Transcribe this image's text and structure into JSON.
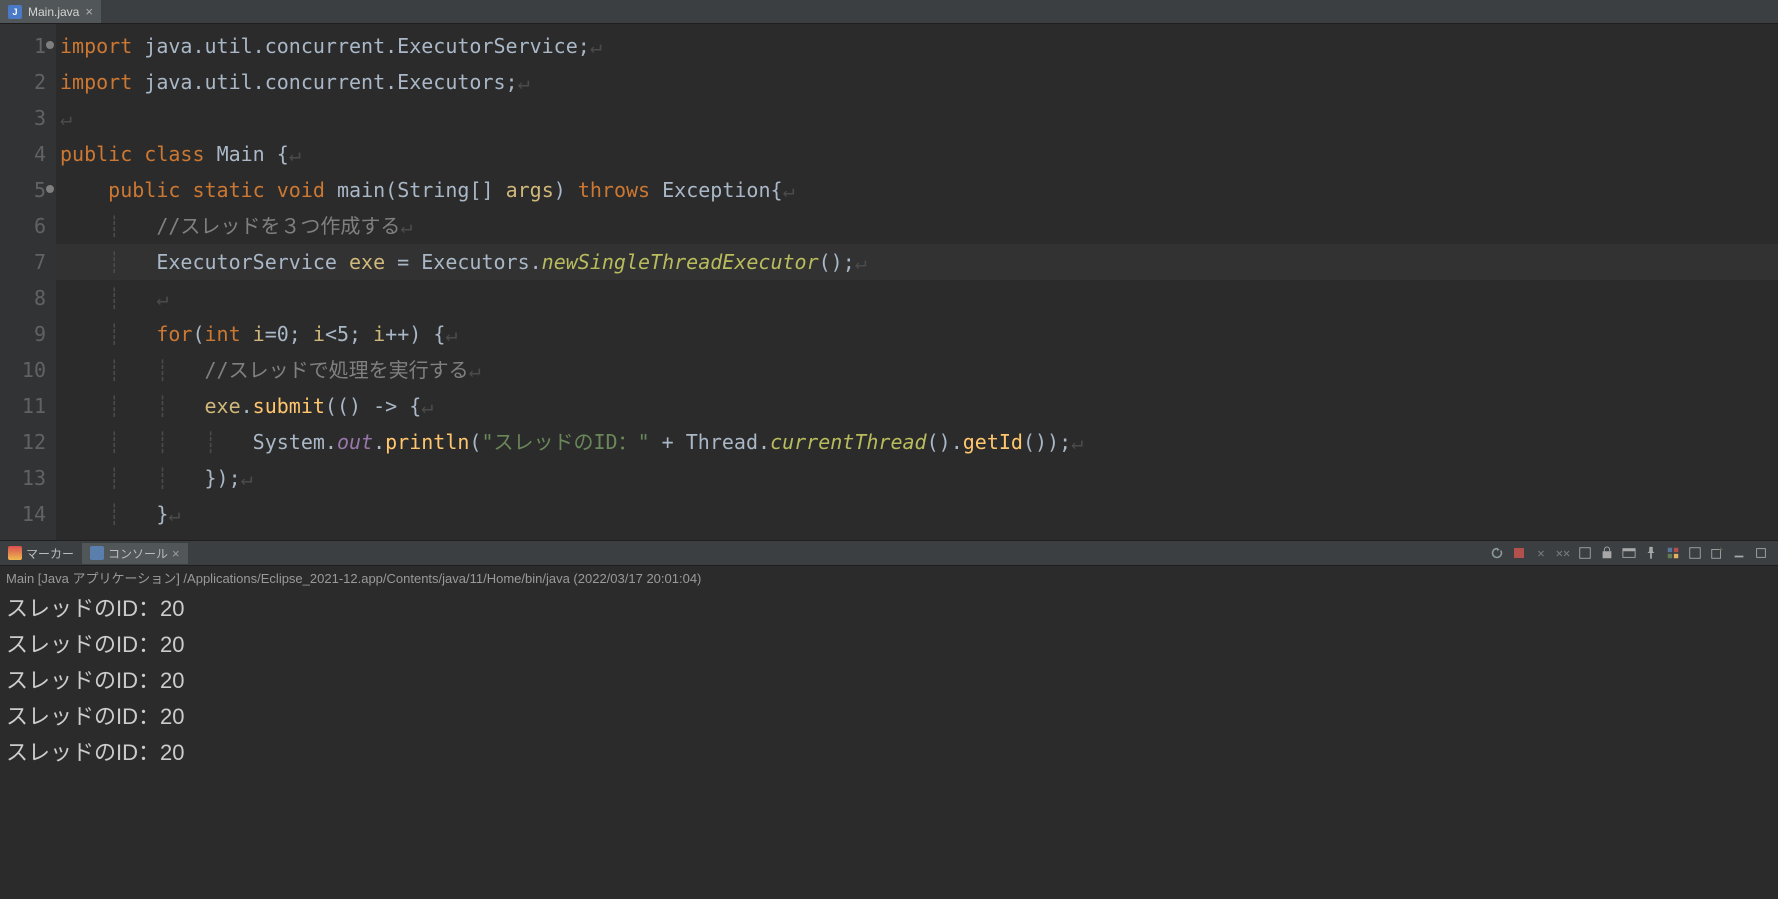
{
  "editor": {
    "tab": {
      "filename": "Main.java",
      "icon_letter": "J"
    },
    "lines": [
      {
        "n": 1,
        "mark": true,
        "tokens": [
          {
            "t": "kw",
            "s": "import"
          },
          {
            "t": "plain",
            "s": " java.util.concurrent.ExecutorService;"
          },
          {
            "t": "ws",
            "s": "↵"
          }
        ]
      },
      {
        "n": 2,
        "tokens": [
          {
            "t": "kw",
            "s": "import"
          },
          {
            "t": "plain",
            "s": " java.util.concurrent.Executors;"
          },
          {
            "t": "ws",
            "s": "↵"
          }
        ]
      },
      {
        "n": 3,
        "tokens": [
          {
            "t": "ws",
            "s": "↵"
          }
        ]
      },
      {
        "n": 4,
        "tokens": [
          {
            "t": "kw",
            "s": "public"
          },
          {
            "t": "plain",
            "s": " "
          },
          {
            "t": "kw",
            "s": "class"
          },
          {
            "t": "plain",
            "s": " "
          },
          {
            "t": "typ",
            "s": "Main"
          },
          {
            "t": "plain",
            "s": " {"
          },
          {
            "t": "ws",
            "s": "↵"
          }
        ]
      },
      {
        "n": 5,
        "mark": true,
        "tokens": [
          {
            "t": "plain",
            "s": "    "
          },
          {
            "t": "kw",
            "s": "public"
          },
          {
            "t": "plain",
            "s": " "
          },
          {
            "t": "kw",
            "s": "static"
          },
          {
            "t": "plain",
            "s": " "
          },
          {
            "t": "kw",
            "s": "void"
          },
          {
            "t": "plain",
            "s": " "
          },
          {
            "t": "main",
            "s": "main"
          },
          {
            "t": "plain",
            "s": "("
          },
          {
            "t": "typ",
            "s": "String"
          },
          {
            "t": "plain",
            "s": "[] "
          },
          {
            "t": "var",
            "s": "args"
          },
          {
            "t": "plain",
            "s": ") "
          },
          {
            "t": "kw",
            "s": "throws"
          },
          {
            "t": "plain",
            "s": " "
          },
          {
            "t": "typ",
            "s": "Exception"
          },
          {
            "t": "plain",
            "s": "{"
          },
          {
            "t": "ws",
            "s": "↵"
          }
        ]
      },
      {
        "n": 6,
        "tokens": [
          {
            "t": "ws",
            "s": "    ┊   "
          },
          {
            "t": "cmt",
            "s": "//スレッドを３つ作成する"
          },
          {
            "t": "ws",
            "s": "↵"
          }
        ]
      },
      {
        "n": 7,
        "current": true,
        "tokens": [
          {
            "t": "ws",
            "s": "    ┊   "
          },
          {
            "t": "typ",
            "s": "ExecutorService"
          },
          {
            "t": "plain",
            "s": " "
          },
          {
            "t": "var",
            "s": "exe"
          },
          {
            "t": "plain",
            "s": " = "
          },
          {
            "t": "typ",
            "s": "Executors"
          },
          {
            "t": "plain",
            "s": "."
          },
          {
            "t": "nst",
            "s": "newSingleThreadExecutor"
          },
          {
            "t": "plain",
            "s": "();"
          },
          {
            "t": "ws",
            "s": "↵"
          }
        ]
      },
      {
        "n": 8,
        "tokens": [
          {
            "t": "ws",
            "s": "    ┊   ↵"
          }
        ]
      },
      {
        "n": 9,
        "tokens": [
          {
            "t": "ws",
            "s": "    ┊   "
          },
          {
            "t": "kw",
            "s": "for"
          },
          {
            "t": "plain",
            "s": "("
          },
          {
            "t": "kw",
            "s": "int"
          },
          {
            "t": "plain",
            "s": " "
          },
          {
            "t": "var",
            "s": "i"
          },
          {
            "t": "plain",
            "s": "=0; "
          },
          {
            "t": "var",
            "s": "i"
          },
          {
            "t": "plain",
            "s": "<5; "
          },
          {
            "t": "var",
            "s": "i"
          },
          {
            "t": "plain",
            "s": "++) {"
          },
          {
            "t": "ws",
            "s": "↵"
          }
        ]
      },
      {
        "n": 10,
        "tokens": [
          {
            "t": "ws",
            "s": "    ┊   ┊   "
          },
          {
            "t": "cmt",
            "s": "//スレッドで処理を実行する"
          },
          {
            "t": "ws",
            "s": "↵"
          }
        ]
      },
      {
        "n": 11,
        "tokens": [
          {
            "t": "ws",
            "s": "    ┊   ┊   "
          },
          {
            "t": "var",
            "s": "exe"
          },
          {
            "t": "plain",
            "s": "."
          },
          {
            "t": "fn",
            "s": "submit"
          },
          {
            "t": "plain",
            "s": "(() -> {"
          },
          {
            "t": "ws",
            "s": "↵"
          }
        ]
      },
      {
        "n": 12,
        "tokens": [
          {
            "t": "ws",
            "s": "    ┊   ┊   ┊   "
          },
          {
            "t": "typ",
            "s": "System"
          },
          {
            "t": "plain",
            "s": "."
          },
          {
            "t": "sfld",
            "s": "out"
          },
          {
            "t": "plain",
            "s": "."
          },
          {
            "t": "fn",
            "s": "println"
          },
          {
            "t": "plain",
            "s": "("
          },
          {
            "t": "str",
            "s": "\"スレッドのID：\""
          },
          {
            "t": "plain",
            "s": " + "
          },
          {
            "t": "typ",
            "s": "Thread"
          },
          {
            "t": "plain",
            "s": "."
          },
          {
            "t": "nst",
            "s": "currentThread"
          },
          {
            "t": "plain",
            "s": "()."
          },
          {
            "t": "fn",
            "s": "getId"
          },
          {
            "t": "plain",
            "s": "());"
          },
          {
            "t": "ws",
            "s": "↵"
          }
        ]
      },
      {
        "n": 13,
        "tokens": [
          {
            "t": "ws",
            "s": "    ┊   ┊   "
          },
          {
            "t": "plain",
            "s": "});"
          },
          {
            "t": "ws",
            "s": "↵"
          }
        ]
      },
      {
        "n": 14,
        "tokens": [
          {
            "t": "ws",
            "s": "    ┊   "
          },
          {
            "t": "plain",
            "s": "}"
          },
          {
            "t": "ws",
            "s": "↵"
          }
        ]
      }
    ]
  },
  "panel": {
    "marker_tab": "マーカー",
    "console_tab": "コンソール",
    "meta": "Main [Java アプリケーション] /Applications/Eclipse_2021-12.app/Contents/java/11/Home/bin/java  (2022/03/17 20:01:04)",
    "output_lines": [
      "スレッドのID：20",
      "スレッドのID：20",
      "スレッドのID：20",
      "スレッドのID：20",
      "スレッドのID：20"
    ]
  }
}
